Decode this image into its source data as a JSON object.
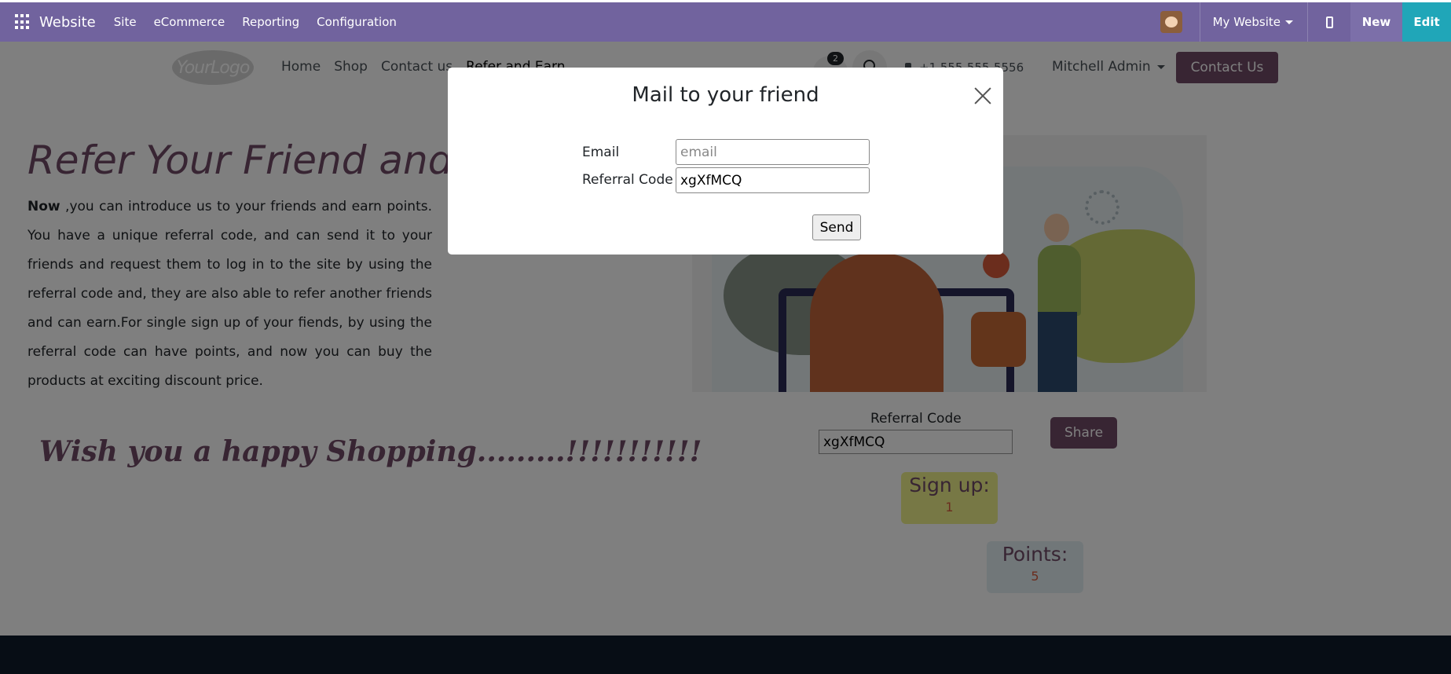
{
  "adminbar": {
    "brand": "Website",
    "menus": [
      "Site",
      "eCommerce",
      "Reporting",
      "Configuration"
    ],
    "website_selector": "My Website",
    "new_label": "New",
    "edit_label": "Edit"
  },
  "header": {
    "logo_text": "YourLogo",
    "nav": [
      "Home",
      "Shop",
      "Contact us",
      "Refer and Earn"
    ],
    "cart_count": "2",
    "phone": "+1 555-555-5556",
    "user": "Mitchell Admin",
    "contact_button": "Contact Us"
  },
  "content": {
    "hero_title": "Refer Your Friend and",
    "intro_bold": "Now",
    "intro_text": " ,you can introduce us to your friends and earn points. You have a unique referral code, and can send it to your friends and request them to log in to the site by using the referral code and, they are also able to refer another friends and can earn.For single sign up of your fiends, by using the referral code can have points, and now you can buy the products at exciting discount price.",
    "wish": "Wish you a happy Shopping.........!!!!!!!!!!!",
    "referral_label": "Referral Code",
    "referral_value": "xgXfMCQ",
    "share_label": "Share",
    "signup_title": "Sign up:",
    "signup_value": "1",
    "points_title": "Points:",
    "points_value": "5"
  },
  "modal": {
    "title": "Mail to your friend",
    "email_label": "Email",
    "email_placeholder": "email",
    "email_value": "",
    "code_label": "Referral Code",
    "code_value": "xgXfMCQ",
    "send_label": "Send"
  },
  "colors": {
    "admin_bar": "#71639e",
    "edit_button": "#20a6b8",
    "brand_primary": "#714b67",
    "footer": "#0f1a2b"
  }
}
